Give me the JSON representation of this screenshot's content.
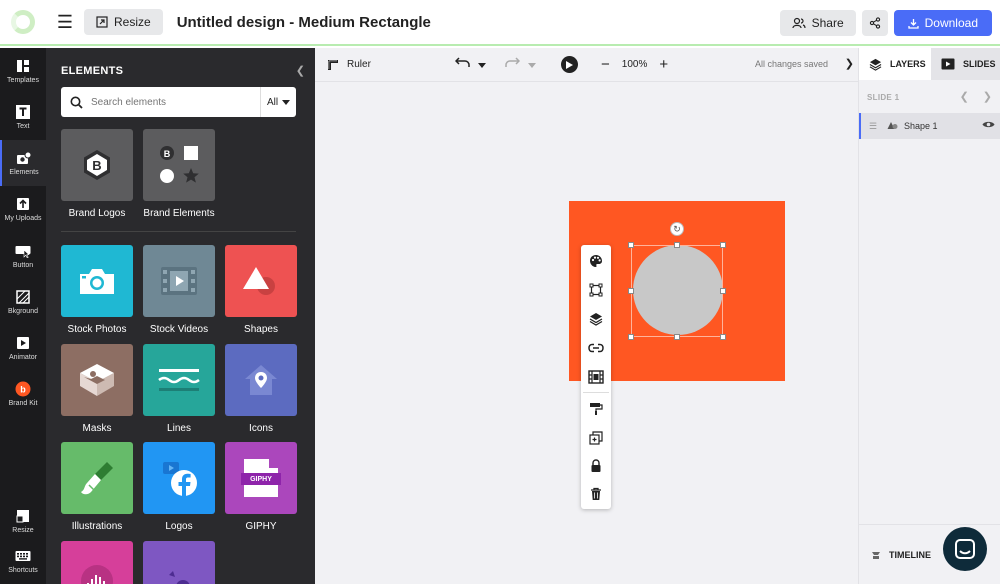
{
  "header": {
    "resize_label": "Resize",
    "title": "Untitled design - Medium Rectangle",
    "share_label": "Share",
    "download_label": "Download",
    "accent_color": "#4a6cf7"
  },
  "rail": {
    "items": [
      {
        "label": "Templates",
        "icon": "templates-icon"
      },
      {
        "label": "Text",
        "icon": "text-icon"
      },
      {
        "label": "Elements",
        "icon": "elements-icon"
      },
      {
        "label": "My Uploads",
        "icon": "uploads-icon"
      },
      {
        "label": "Button",
        "icon": "button-icon"
      },
      {
        "label": "Bkground",
        "icon": "background-icon"
      },
      {
        "label": "Animator",
        "icon": "animator-icon"
      },
      {
        "label": "Brand Kit",
        "icon": "brand-kit-icon"
      },
      {
        "label": "Resize",
        "icon": "resize-icon"
      },
      {
        "label": "Shortcuts",
        "icon": "keyboard-icon"
      }
    ],
    "active": "Elements"
  },
  "panel": {
    "title": "ELEMENTS",
    "search_placeholder": "Search elements",
    "filter_value": "All",
    "tiles": [
      {
        "label": "Brand Logos",
        "color": "#5c5c5e"
      },
      {
        "label": "Brand Elements",
        "color": "#5c5c5e"
      },
      {
        "label": "Stock Photos",
        "color": "#1fb8d3"
      },
      {
        "label": "Stock Videos",
        "color": "#6f8895"
      },
      {
        "label": "Shapes",
        "color": "#ee5252"
      },
      {
        "label": "Masks",
        "color": "#8d6e63"
      },
      {
        "label": "Lines",
        "color": "#26a69a"
      },
      {
        "label": "Icons",
        "color": "#5c6bc0"
      },
      {
        "label": "Illustrations",
        "color": "#66bb6a"
      },
      {
        "label": "Logos",
        "color": "#2196f3"
      },
      {
        "label": "GIPHY",
        "color": "#ab47bc"
      }
    ],
    "giphy_text": "GIPHY"
  },
  "toolbar": {
    "ruler_label": "Ruler",
    "zoom_level": "100%",
    "save_status": "All changes saved"
  },
  "canvas": {
    "artboard_color": "#ff5722",
    "shape_color": "#c8c8c8"
  },
  "context_menu": {
    "items": [
      "palette-icon",
      "transform-icon",
      "layers-icon",
      "link-icon",
      "filmstrip-icon",
      "paint-roller-icon",
      "duplicate-icon",
      "lock-icon",
      "trash-icon"
    ]
  },
  "right_panel": {
    "tab_layers": "LAYERS",
    "tab_slides": "SLIDES",
    "slide_label": "SLIDE 1",
    "layer_name": "Shape 1",
    "timeline_label": "TIMELINE"
  }
}
